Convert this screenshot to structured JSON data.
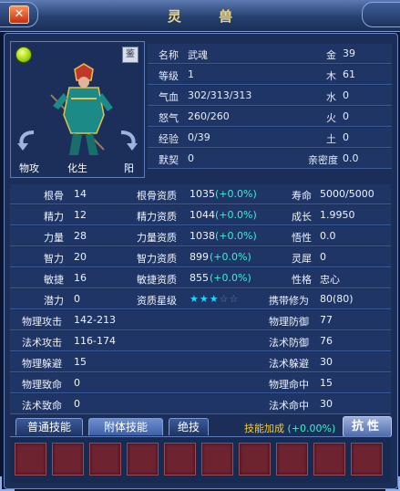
{
  "window": {
    "title": "灵 兽",
    "close_label": "✕"
  },
  "portrait": {
    "appraise_label": "鉴",
    "labels": [
      "物攻",
      "化生",
      "阳"
    ]
  },
  "info": [
    {
      "k": "名称",
      "v": "武魂",
      "k2": "金",
      "v2": "39"
    },
    {
      "k": "等级",
      "v": "1",
      "k2": "木",
      "v2": "61"
    },
    {
      "k": "气血",
      "v": "302/313/313",
      "k2": "水",
      "v2": "0"
    },
    {
      "k": "怒气",
      "v": "260/260",
      "k2": "火",
      "v2": "0"
    },
    {
      "k": "经验",
      "v": "0/39",
      "k2": "土",
      "v2": "0"
    },
    {
      "k": "默契",
      "v": "0",
      "k2": "亲密度",
      "v2": "0.0"
    }
  ],
  "attributes": [
    {
      "k": "根骨",
      "v": "14",
      "q": "根骨资质",
      "qv": "1035",
      "qb": "(+0.0%)",
      "k3": "寿命",
      "v3": "5000/5000"
    },
    {
      "k": "精力",
      "v": "12",
      "q": "精力资质",
      "qv": "1044",
      "qb": "(+0.0%)",
      "k3": "成长",
      "v3": "1.9950"
    },
    {
      "k": "力量",
      "v": "28",
      "q": "力量资质",
      "qv": "1038",
      "qb": "(+0.0%)",
      "k3": "悟性",
      "v3": "0.0"
    },
    {
      "k": "智力",
      "v": "20",
      "q": "智力资质",
      "qv": "899",
      "qb": "(+0.0%)",
      "k3": "灵犀",
      "v3": "0"
    },
    {
      "k": "敏捷",
      "v": "16",
      "q": "敏捷资质",
      "qv": "855",
      "qb": "(+0.0%)",
      "k3": "性格",
      "v3": "忠心"
    }
  ],
  "potential": {
    "k": "潜力",
    "v": "0",
    "q": "资质星级",
    "stars_filled": 3,
    "stars_total": 5,
    "k3": "携带修为",
    "v3": "80(80)"
  },
  "combat": [
    {
      "k": "物理攻击",
      "v": "142-213",
      "k2": "物理防御",
      "v2": "77"
    },
    {
      "k": "法术攻击",
      "v": "116-174",
      "k2": "法术防御",
      "v2": "76"
    },
    {
      "k": "物理躲避",
      "v": "15",
      "k2": "法术躲避",
      "v2": "30"
    },
    {
      "k": "物理致命",
      "v": "0",
      "k2": "物理命中",
      "v2": "15"
    },
    {
      "k": "法术致命",
      "v": "0",
      "k2": "法术命中",
      "v2": "30"
    }
  ],
  "tabs": [
    {
      "label": "普通技能",
      "active": false
    },
    {
      "label": "附体技能",
      "active": true
    },
    {
      "label": "绝技",
      "active": false
    }
  ],
  "skill_bonus": {
    "label": "技能加成",
    "value": "(+0.00%)"
  },
  "resist_button": "抗性",
  "skill_slots": 10,
  "colors": {
    "highlight": "#39f0d0",
    "star": "#1ad8ff",
    "slot": "#6e2331",
    "title": "#e8d58a"
  }
}
